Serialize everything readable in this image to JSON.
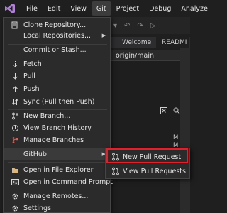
{
  "menubar": {
    "items": [
      "File",
      "Edit",
      "View",
      "Git",
      "Project",
      "Debug",
      "Analyze"
    ]
  },
  "tabs": {
    "welcome": "Welcome",
    "readme": "READMI"
  },
  "branch": {
    "value": "origin/main"
  },
  "status_letters": [
    "M",
    "M",
    "M"
  ],
  "git_menu": {
    "items": [
      {
        "label": "Clone Repository...",
        "icon": "clone-icon"
      },
      {
        "label": "Local Repositories...",
        "icon": "",
        "submenu": true
      },
      {
        "label": "Commit or Stash...",
        "icon": ""
      },
      {
        "label": "Fetch",
        "icon": "fetch-icon"
      },
      {
        "label": "Pull",
        "icon": "pull-icon"
      },
      {
        "label": "Push",
        "icon": "push-icon"
      },
      {
        "label": "Sync (Pull then Push)",
        "icon": "sync-icon"
      },
      {
        "label": "New Branch...",
        "icon": "new-branch-icon"
      },
      {
        "label": "View Branch History",
        "icon": "history-icon"
      },
      {
        "label": "Manage Branches",
        "icon": "manage-branches-icon"
      },
      {
        "label": "GitHub",
        "icon": "",
        "submenu": true
      },
      {
        "label": "Open in File Explorer",
        "icon": "folder-icon"
      },
      {
        "label": "Open in Command Prompt",
        "icon": "terminal-icon"
      },
      {
        "label": "Manage Remotes...",
        "icon": "gear-icon"
      },
      {
        "label": "Settings",
        "icon": "settings-icon"
      }
    ]
  },
  "github_submenu": {
    "items": [
      {
        "label": "New Pull Request",
        "icon": "pull-request-icon"
      },
      {
        "label": "View Pull Requests",
        "icon": "pull-request-icon"
      }
    ]
  },
  "colors": {
    "accent_highlight": "#e0202a",
    "menu_bg": "#2b2b2b",
    "window_bg": "#1f1f1f"
  }
}
